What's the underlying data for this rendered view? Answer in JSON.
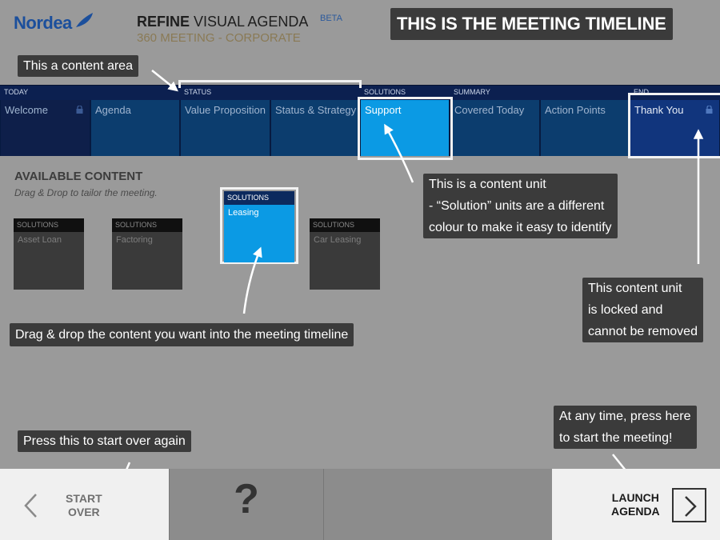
{
  "header": {
    "logo": "Nordea",
    "title_bold": "REFINE",
    "title_rest": " VISUAL AGENDA",
    "beta": "BETA",
    "subtitle": "360 MEETING - CORPORATE"
  },
  "callouts": {
    "timeline": "THIS IS THE MEETING TIMELINE",
    "content_area": "This a content area",
    "content_unit": [
      "This is a content unit",
      " - “Solution” units are a different",
      " colour to make it easy to identify"
    ],
    "locked": [
      "This content unit",
      " is locked and",
      "cannot be removed"
    ],
    "drag_drop": "Drag & drop the content you want into the meeting timeline",
    "start_over": "Press this to start over again",
    "launch": [
      "At any time, press here",
      "to start the meeting!"
    ]
  },
  "timeline": {
    "sections": [
      {
        "label": "TODAY"
      },
      {
        "label": "STATUS"
      },
      {
        "label": "SOLUTIONS"
      },
      {
        "label": "SUMMARY"
      },
      {
        "label": "END"
      }
    ],
    "units": [
      {
        "label": "Welcome",
        "locked": true,
        "color": "#0e1f4a"
      },
      {
        "label": "Agenda",
        "locked": false,
        "color": "#0c3d6e"
      },
      {
        "label": "Value Proposition",
        "locked": false,
        "color": "#0c3d6e"
      },
      {
        "label": "Status & Strategy",
        "locked": false,
        "color": "#0c3d6e"
      },
      {
        "label": "Support",
        "locked": false,
        "color": "#0b9ae4"
      },
      {
        "label": "Covered Today",
        "locked": false,
        "color": "#0c3d6e"
      },
      {
        "label": "Action Points",
        "locked": false,
        "color": "#0c3d6e"
      },
      {
        "label": "Thank You",
        "locked": true,
        "color": "#11357d"
      }
    ]
  },
  "available": {
    "title": "AVAILABLE CONTENT",
    "subtitle": "Drag & Drop to tailor the meeting.",
    "cards": [
      {
        "section": "SOLUTIONS",
        "label": "Asset Loan"
      },
      {
        "section": "SOLUTIONS",
        "label": "Factoring"
      },
      {
        "section": "SOLUTIONS",
        "label": "Leasing"
      },
      {
        "section": "SOLUTIONS",
        "label": "Car Leasing"
      }
    ]
  },
  "bottom": {
    "start_over": [
      "START",
      "OVER"
    ],
    "help": "?",
    "launch": [
      "LAUNCH",
      "AGENDA"
    ]
  },
  "colors": {
    "background": "#9a9a9a",
    "timeline_bg": "#0c2050",
    "solution_blue": "#0b9ae4",
    "callout_bg": "#3b3b3b",
    "brand_blue": "#1b4f9c"
  }
}
